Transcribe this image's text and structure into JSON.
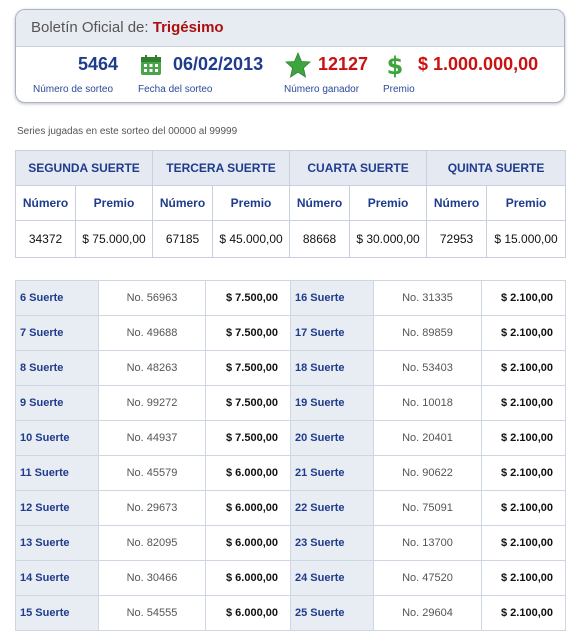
{
  "header": {
    "title_prefix": "Boletín Oficial de:",
    "title_name": "Trigésimo",
    "sorteo_number": "5464",
    "sorteo_number_label": "Número de sorteo",
    "sorteo_date": "06/02/2013",
    "sorteo_date_label": "Fecha del sorteo",
    "winning_number": "12127",
    "winning_number_label": "Número ganador",
    "prize": "$ 1.000.000,00",
    "prize_label": "Premio",
    "icons": [
      "calendar-icon",
      "star-icon",
      "dollar-icon"
    ]
  },
  "series_text": "Series jugadas en este sorteo del 00000 al 99999",
  "top_table": {
    "groups": [
      "SEGUNDA SUERTE",
      "TERCERA SUERTE",
      "CUARTA SUERTE",
      "QUINTA SUERTE"
    ],
    "col_numero": "Número",
    "col_premio": "Premio",
    "rows": [
      {
        "numero": "34372",
        "premio": "$ 75.000,00"
      },
      {
        "numero": "67185",
        "premio": "$ 45.000,00"
      },
      {
        "numero": "88668",
        "premio": "$ 30.000,00"
      },
      {
        "numero": "72953",
        "premio": "$ 15.000,00"
      }
    ]
  },
  "bottom_table": {
    "rows": [
      {
        "l_label": "6 Suerte",
        "l_num": "No. 56963",
        "l_prize": "$ 7.500,00",
        "r_label": "16 Suerte",
        "r_num": "No. 31335",
        "r_prize": "$ 2.100,00"
      },
      {
        "l_label": "7 Suerte",
        "l_num": "No. 49688",
        "l_prize": "$ 7.500,00",
        "r_label": "17 Suerte",
        "r_num": "No. 89859",
        "r_prize": "$ 2.100,00"
      },
      {
        "l_label": "8 Suerte",
        "l_num": "No. 48263",
        "l_prize": "$ 7.500,00",
        "r_label": "18 Suerte",
        "r_num": "No. 53403",
        "r_prize": "$ 2.100,00"
      },
      {
        "l_label": "9 Suerte",
        "l_num": "No. 99272",
        "l_prize": "$ 7.500,00",
        "r_label": "19 Suerte",
        "r_num": "No. 10018",
        "r_prize": "$ 2.100,00"
      },
      {
        "l_label": "10 Suerte",
        "l_num": "No. 44937",
        "l_prize": "$ 7.500,00",
        "r_label": "20 Suerte",
        "r_num": "No. 20401",
        "r_prize": "$ 2.100,00"
      },
      {
        "l_label": "11 Suerte",
        "l_num": "No. 45579",
        "l_prize": "$ 6.000,00",
        "r_label": "21 Suerte",
        "r_num": "No. 90622",
        "r_prize": "$ 2.100,00"
      },
      {
        "l_label": "12 Suerte",
        "l_num": "No. 29673",
        "l_prize": "$ 6.000,00",
        "r_label": "22 Suerte",
        "r_num": "No. 75091",
        "r_prize": "$ 2.100,00"
      },
      {
        "l_label": "13 Suerte",
        "l_num": "No. 82095",
        "l_prize": "$ 6.000,00",
        "r_label": "23 Suerte",
        "r_num": "No. 13700",
        "r_prize": "$ 2.100,00"
      },
      {
        "l_label": "14 Suerte",
        "l_num": "No. 30466",
        "l_prize": "$ 6.000,00",
        "r_label": "24 Suerte",
        "r_num": "No. 47520",
        "r_prize": "$ 2.100,00"
      },
      {
        "l_label": "15 Suerte",
        "l_num": "No. 54555",
        "l_prize": "$ 6.000,00",
        "r_label": "25 Suerte",
        "r_num": "No. 29604",
        "r_prize": "$ 2.100,00"
      }
    ]
  },
  "colors": {
    "accent_blue": "#1f3b8c",
    "prize_red": "#cc1111",
    "title_name_red": "#aa1111",
    "icon_green": "#3ea53e",
    "header_bg": "#e7ebf2"
  }
}
